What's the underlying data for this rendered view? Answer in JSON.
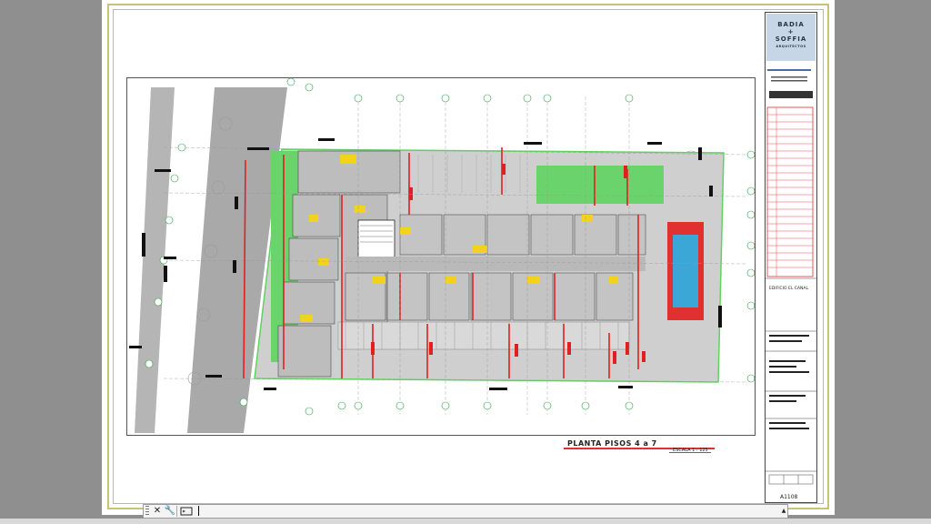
{
  "drawing": {
    "firm_name_line1": "BADIA",
    "firm_name_sep": "+",
    "firm_name_line2": "SOFFIA",
    "firm_subtitle": "ARQUITECTOS",
    "project_name": "EDIFICIO EL CANAL",
    "plan_title": "PLANTA PISOS 4 a 7",
    "plan_scale": "ESCALA 1 : 125",
    "sheet_number": "A1108"
  },
  "command_line": {
    "close_icon": "close-icon",
    "customize_icon": "wrench-icon",
    "prompt_icon": "command-prompt-icon",
    "history_icon": "chevron-up-icon",
    "input_value": "",
    "input_placeholder": ""
  },
  "colors": {
    "wall": "#e02020",
    "green_area": "#5fd35f",
    "pool": "#3aa7d6",
    "floor": "#c9c9c9",
    "sheet_frame": "#c8c474"
  }
}
